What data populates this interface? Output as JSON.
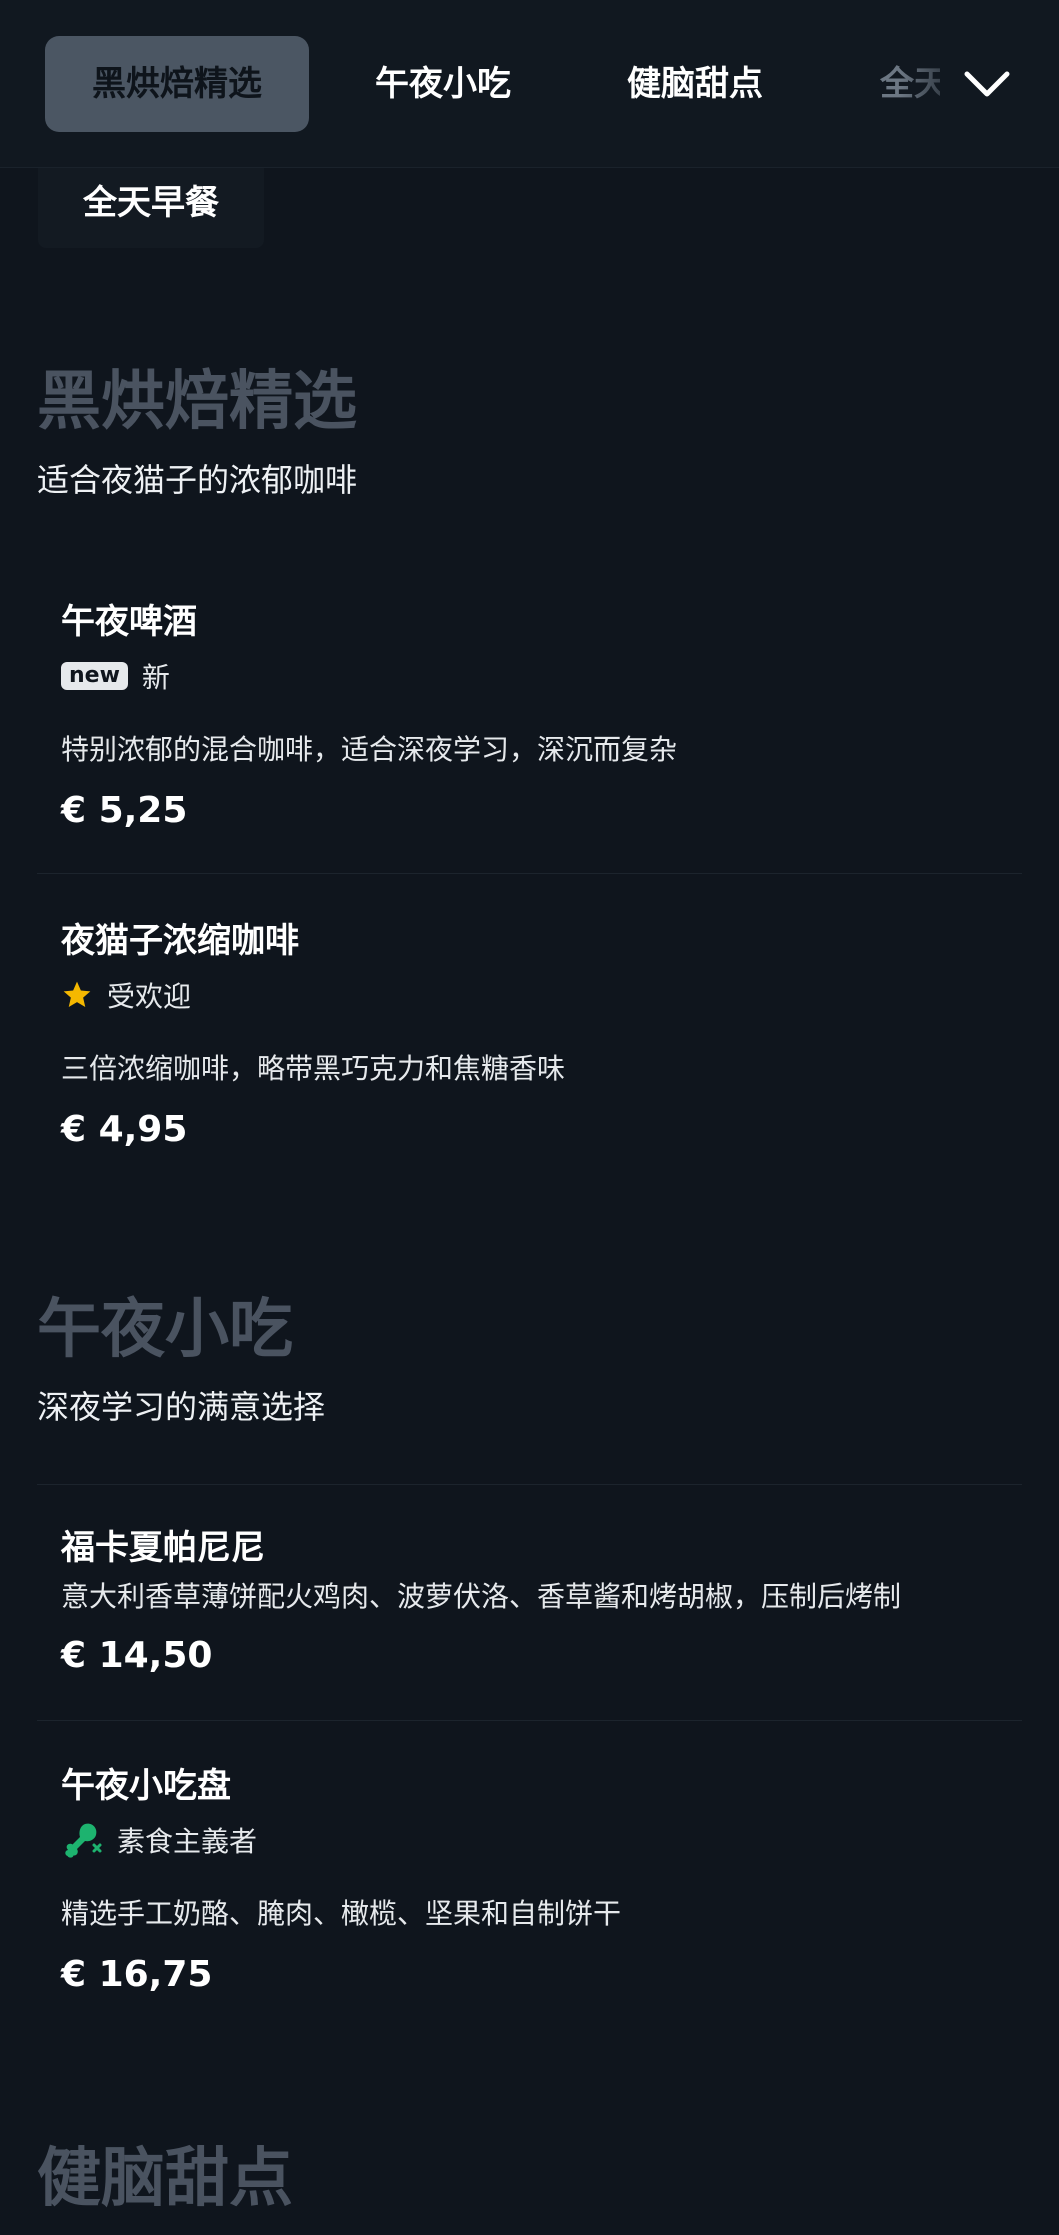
{
  "tabs": [
    {
      "label": "黑烘焙精选",
      "active": true
    },
    {
      "label": "午夜小吃"
    },
    {
      "label": "健脑甜点"
    },
    {
      "label": "全天早餐"
    }
  ],
  "tab_partial_label": "全天",
  "overflow_tab_label": "全天早餐",
  "sections": [
    {
      "title": "黑烘焙精选",
      "subtitle": "适合夜猫子的浓郁咖啡",
      "items": [
        {
          "name": "午夜啤酒",
          "badge": "new",
          "tag": "新",
          "description": "特别浓郁的混合咖啡，适合深夜学习，深沉而复杂",
          "price": "€ 5,25"
        },
        {
          "name": "夜猫子浓缩咖啡",
          "tag_icon": "star-icon",
          "tag": "受欢迎",
          "description": "三倍浓缩咖啡，略带黑巧克力和焦糖香味",
          "price": "€ 4,95"
        }
      ]
    },
    {
      "title": "午夜小吃",
      "subtitle": "深夜学习的满意选择",
      "items": [
        {
          "name": "福卡夏帕尼尼",
          "description": "意大利香草薄饼配火鸡肉、波萝伏洛、香草酱和烤胡椒，压制后烤制",
          "price": "€ 14,50"
        },
        {
          "name": "午夜小吃盘",
          "tag_icon": "vegetarian-drumstick-icon",
          "tag": "素食主義者",
          "description": "精选手工奶酪、腌肉、橄榄、坚果和自制饼干",
          "price": "€ 16,75"
        }
      ]
    },
    {
      "title": "健脑甜点"
    }
  ],
  "colors": {
    "background": "#0f151d",
    "active_tab": "#4b5663",
    "section_title": "#4a5360",
    "star": "#f5b800",
    "vegetarian": "#1db36f"
  }
}
